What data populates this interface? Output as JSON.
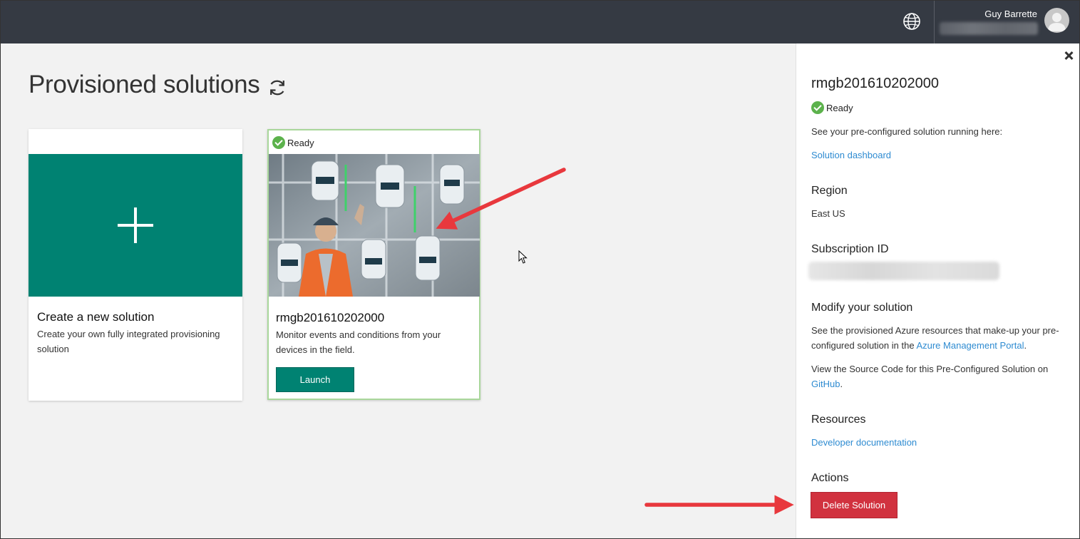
{
  "topbar": {
    "user_name": "Guy Barrette",
    "globe_icon": "globe-icon",
    "avatar_icon": "avatar-icon"
  },
  "main": {
    "title": "Provisioned solutions",
    "refresh_icon": "refresh-icon",
    "cards": [
      {
        "title": "Create a new solution",
        "description": "Create your own fully integrated provisioning solution",
        "icon": "plus-icon",
        "tile_color": "#008272"
      },
      {
        "status": "Ready",
        "title": "rmgb201610202000",
        "description": "Monitor events and conditions from your devices in the field.",
        "button_label": "Launch",
        "image": "industrial-worker-photo"
      }
    ]
  },
  "panel": {
    "title": "rmgb201610202000",
    "status": "Ready",
    "intro": "See your pre-configured solution running here:",
    "dashboard_link": "Solution dashboard",
    "region_heading": "Region",
    "region_value": "East US",
    "subscription_heading": "Subscription ID",
    "modify_heading": "Modify your solution",
    "modify_text_1": "See the provisioned Azure resources that make-up your pre-configured solution in the",
    "modify_link": "Azure Management Portal",
    "modify_text_1_end": ".",
    "source_text": "View the Source Code for this Pre-Configured Solution on",
    "github_link": "GitHub",
    "source_text_end": ".",
    "resources_heading": "Resources",
    "docs_link": "Developer documentation",
    "actions_heading": "Actions",
    "delete_label": "Delete Solution"
  },
  "colors": {
    "topbar": "#353a43",
    "accent_green": "#008272",
    "ready_green": "#5cb24c",
    "link_blue": "#2e8bd1",
    "delete_red": "#d1323f",
    "annotation_arrow": "#e8383d"
  }
}
